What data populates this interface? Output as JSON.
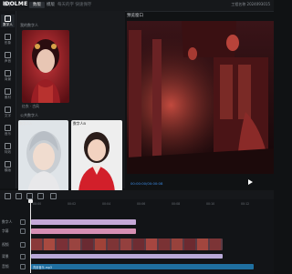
{
  "app": {
    "logo": "IDOLME",
    "tab_edit": "数版",
    "tab_assets": "模版",
    "doc_status": "每天的字 快速保存",
    "right_status": "工程名称 2024093015"
  },
  "sidebar": {
    "items": [
      {
        "label": "数字人",
        "active": true
      },
      {
        "label": "形象",
        "active": false
      },
      {
        "label": "声音",
        "active": false
      },
      {
        "label": "背景",
        "active": false
      },
      {
        "label": "素材",
        "active": false
      },
      {
        "label": "文字",
        "active": false
      },
      {
        "label": "音乐",
        "active": false
      },
      {
        "label": "特效",
        "active": false
      },
      {
        "label": "模版",
        "active": false
      }
    ]
  },
  "panel": {
    "title": "数字人",
    "section_custom": "我的数字人",
    "custom_caption": "红衣 · 古风",
    "section_public": "公共数字人",
    "card_a_caption": "数字人A",
    "card_b_caption": "数字人B"
  },
  "preview": {
    "title": "预览窗口",
    "timecode": "00:00:00/00:00:08"
  },
  "timeline": {
    "ticks": [
      "00:00",
      "00:02",
      "00:04",
      "00:06",
      "00:08",
      "00:10",
      "00:12"
    ],
    "tracks": [
      {
        "label": "数字人"
      },
      {
        "label": "字幕"
      },
      {
        "label": "视频"
      },
      {
        "label": "背景"
      },
      {
        "label": "音频"
      }
    ],
    "audio_clip_label": "背景音乐.mp3"
  },
  "colors": {
    "accent": "#3d8ee8",
    "subtitle_clip": "#c6a9d8",
    "pink_clip": "#d68fb3",
    "audio_clip": "#1f6fa0"
  }
}
